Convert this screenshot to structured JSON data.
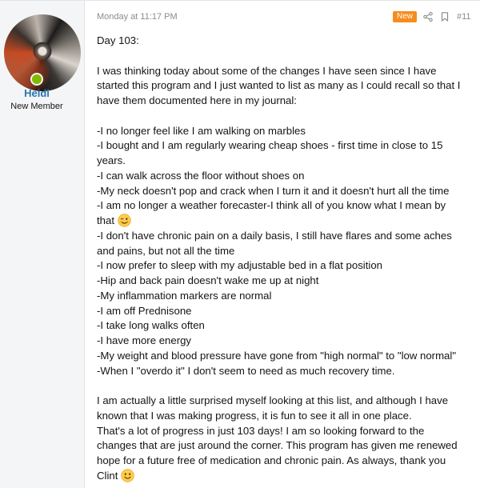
{
  "user": {
    "name": "Heidi",
    "title": "New Member"
  },
  "post": {
    "date": "Monday at 11:17 PM",
    "badge": "New",
    "number": "#11"
  },
  "icons": {
    "share": "share-icon",
    "bookmark": "bookmark-icon",
    "wink": "wink-emoji-icon",
    "smile": "smile-emoji-icon"
  },
  "colors": {
    "username": "#2577b1",
    "badge": "#f78c1d",
    "online": "#7fb900"
  },
  "body": {
    "l0": "Day 103:",
    "l1": "I was thinking today about some of the changes I have seen since I have",
    "l2": "started this program and I just wanted to list as many as I could recall so that I",
    "l3": "have them documented here in my journal:",
    "l4": "-I no longer feel like I am walking on marbles",
    "l5": "-I bought and I am regularly wearing cheap shoes - first time in close to 15",
    "l6": "years.",
    "l7": "-I can walk across the floor without shoes on",
    "l8": "-My neck doesn't pop and crack when I turn it and it doesn't hurt all the time",
    "l9": "-I am no longer a weather forecaster-I think all of you know what I mean by",
    "l10": "that",
    "l11": "-I don't have chronic pain on a daily basis, I still have flares and some aches",
    "l12": "and pains, but not all the time",
    "l13": "-I now prefer to sleep with my adjustable bed in a flat position",
    "l14": "-Hip and back pain doesn't wake me up at night",
    "l15": "-My inflammation markers are normal",
    "l16": "-I am off Prednisone",
    "l17": "-I take long walks often",
    "l18": "-I have more energy",
    "l19": "-My weight and blood pressure have gone from \"high normal\" to \"low normal\"",
    "l20": "-When I \"overdo it\" I don't seem to need as much recovery time.",
    "l21": "I am actually a little surprised myself looking at this list, and although I have",
    "l22": "known that I was making progress, it is fun to see it all in one place.",
    "l23": "That's a lot of progress in just 103 days! I am so looking forward to the",
    "l24": "changes that are just around the corner. This program has given me renewed",
    "l25": "hope for a future free of medication and chronic pain. As always, thank you",
    "l26": "Clint"
  }
}
